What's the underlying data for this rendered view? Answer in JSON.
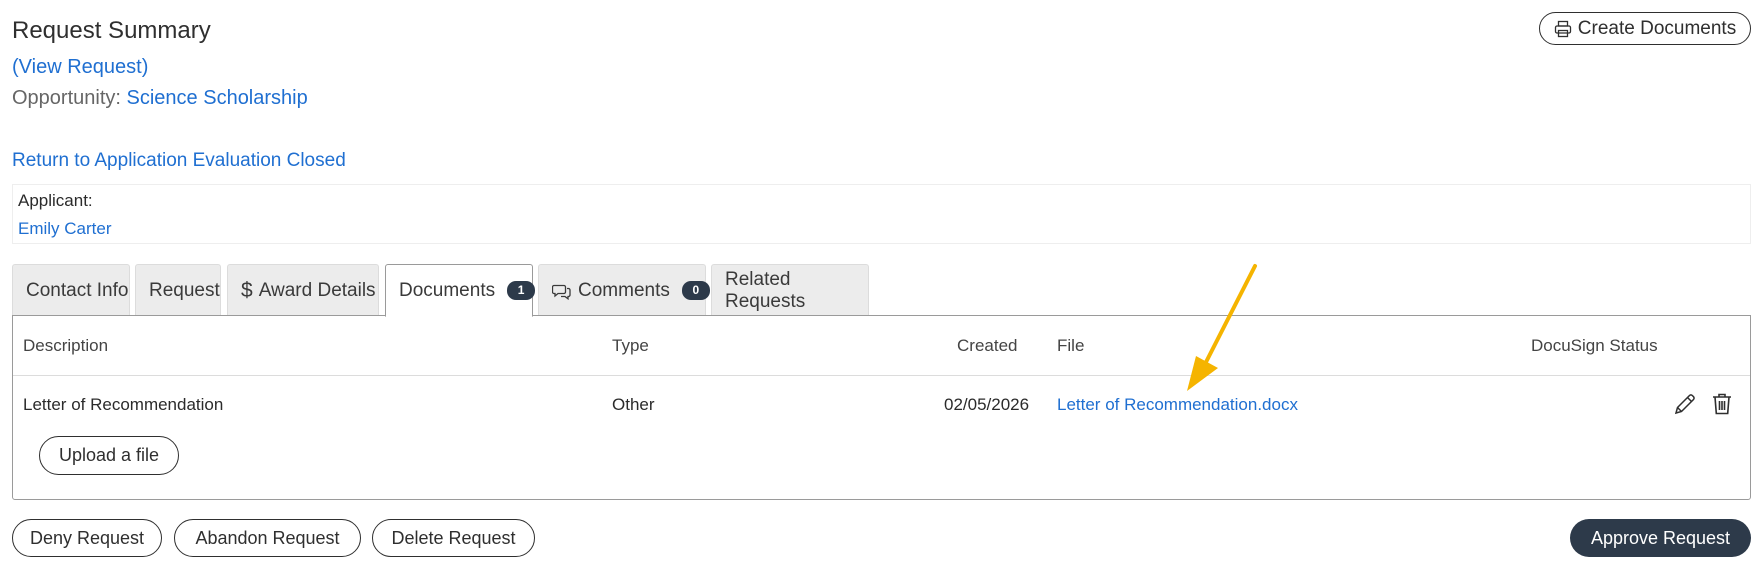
{
  "header": {
    "title": "Request Summary",
    "view_request": "(View Request)",
    "opportunity_label": "Opportunity:",
    "opportunity_value": "Science Scholarship",
    "return_link": "Return to Application Evaluation Closed",
    "create_documents": "Create Documents"
  },
  "applicant": {
    "label": "Applicant:",
    "name": "Emily Carter"
  },
  "tabs": [
    {
      "label": "Contact Info"
    },
    {
      "label": "Request"
    },
    {
      "label": "Award Details",
      "icon": "dollar-icon"
    },
    {
      "label": "Documents",
      "badge": "1",
      "active": true
    },
    {
      "label": "Comments",
      "badge": "0",
      "icon": "comments-icon"
    },
    {
      "label": "Related Requests"
    }
  ],
  "documents": {
    "columns": [
      "Description",
      "Type",
      "Created",
      "File",
      "DocuSign Status"
    ],
    "rows": [
      {
        "description": "Letter of Recommendation",
        "type": "Other",
        "created": "02/05/2026",
        "file": "Letter of Recommendation.docx",
        "docusign_status": "",
        "actions": [
          "edit-icon",
          "trash-icon"
        ]
      }
    ],
    "upload_label": "Upload a file"
  },
  "footer": {
    "deny": "Deny Request",
    "abandon": "Abandon Request",
    "delete": "Delete Request",
    "approve": "Approve Request"
  },
  "colors": {
    "link": "#1f6fd1",
    "primary_button": "#2d3a4a",
    "annotation_arrow": "#f5b400"
  }
}
